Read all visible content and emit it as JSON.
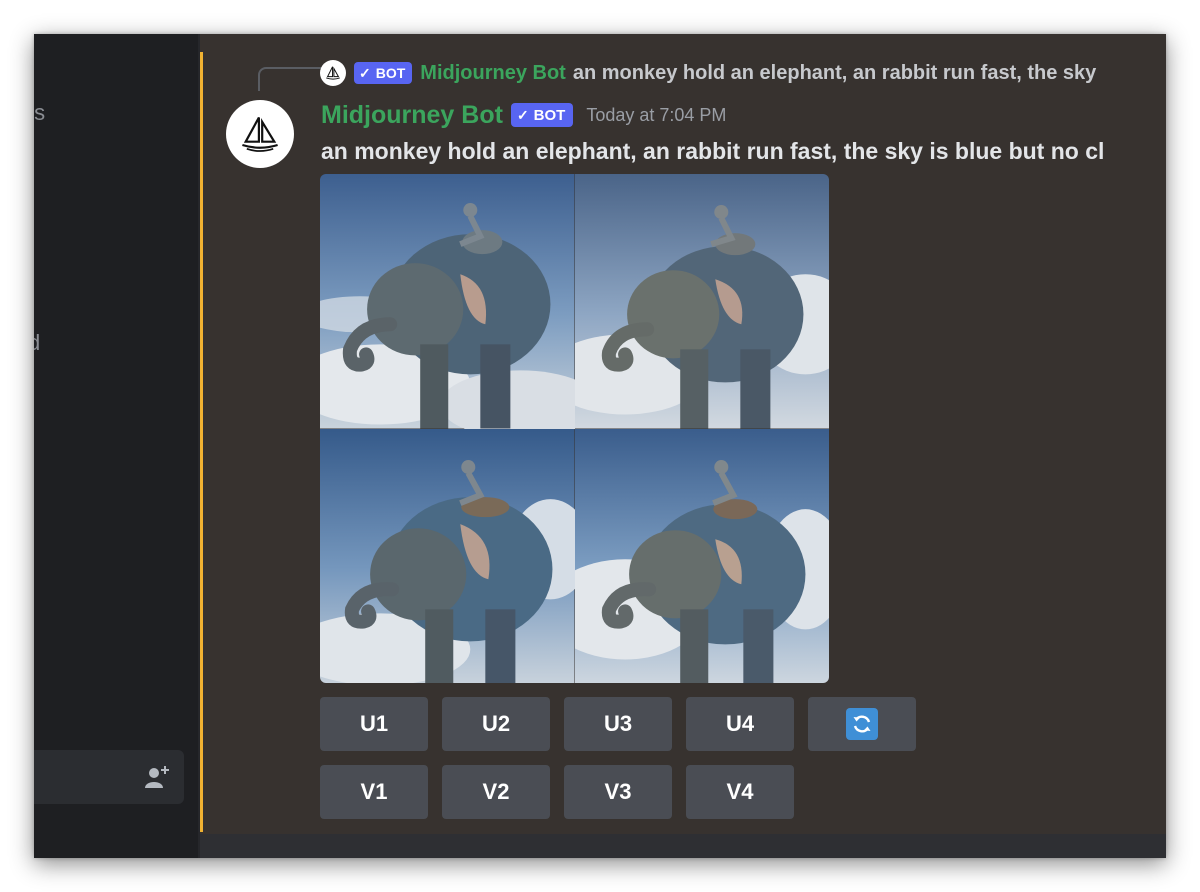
{
  "sidebar": {
    "fragment_top": "ts",
    "fragment_mid": "d",
    "invite_icon": "add-friend-icon"
  },
  "reply": {
    "bot_label": "BOT",
    "username": "Midjourney Bot",
    "text": "an monkey hold an elephant, an rabbit run fast, the sky"
  },
  "message": {
    "username": "Midjourney Bot",
    "bot_label": "BOT",
    "timestamp": "Today at 7:04 PM",
    "prompt": "an monkey hold an elephant, an rabbit run fast, the sky is blue but no cl"
  },
  "buttons": {
    "upscale": [
      "U1",
      "U2",
      "U3",
      "U4"
    ],
    "variation": [
      "V1",
      "V2",
      "V3",
      "V4"
    ],
    "reroll_icon": "refresh-icon"
  },
  "colors": {
    "accent_bar": "#f0b232",
    "username": "#3ba55d",
    "bot_badge": "#5865f2",
    "button": "#4a4d54"
  }
}
